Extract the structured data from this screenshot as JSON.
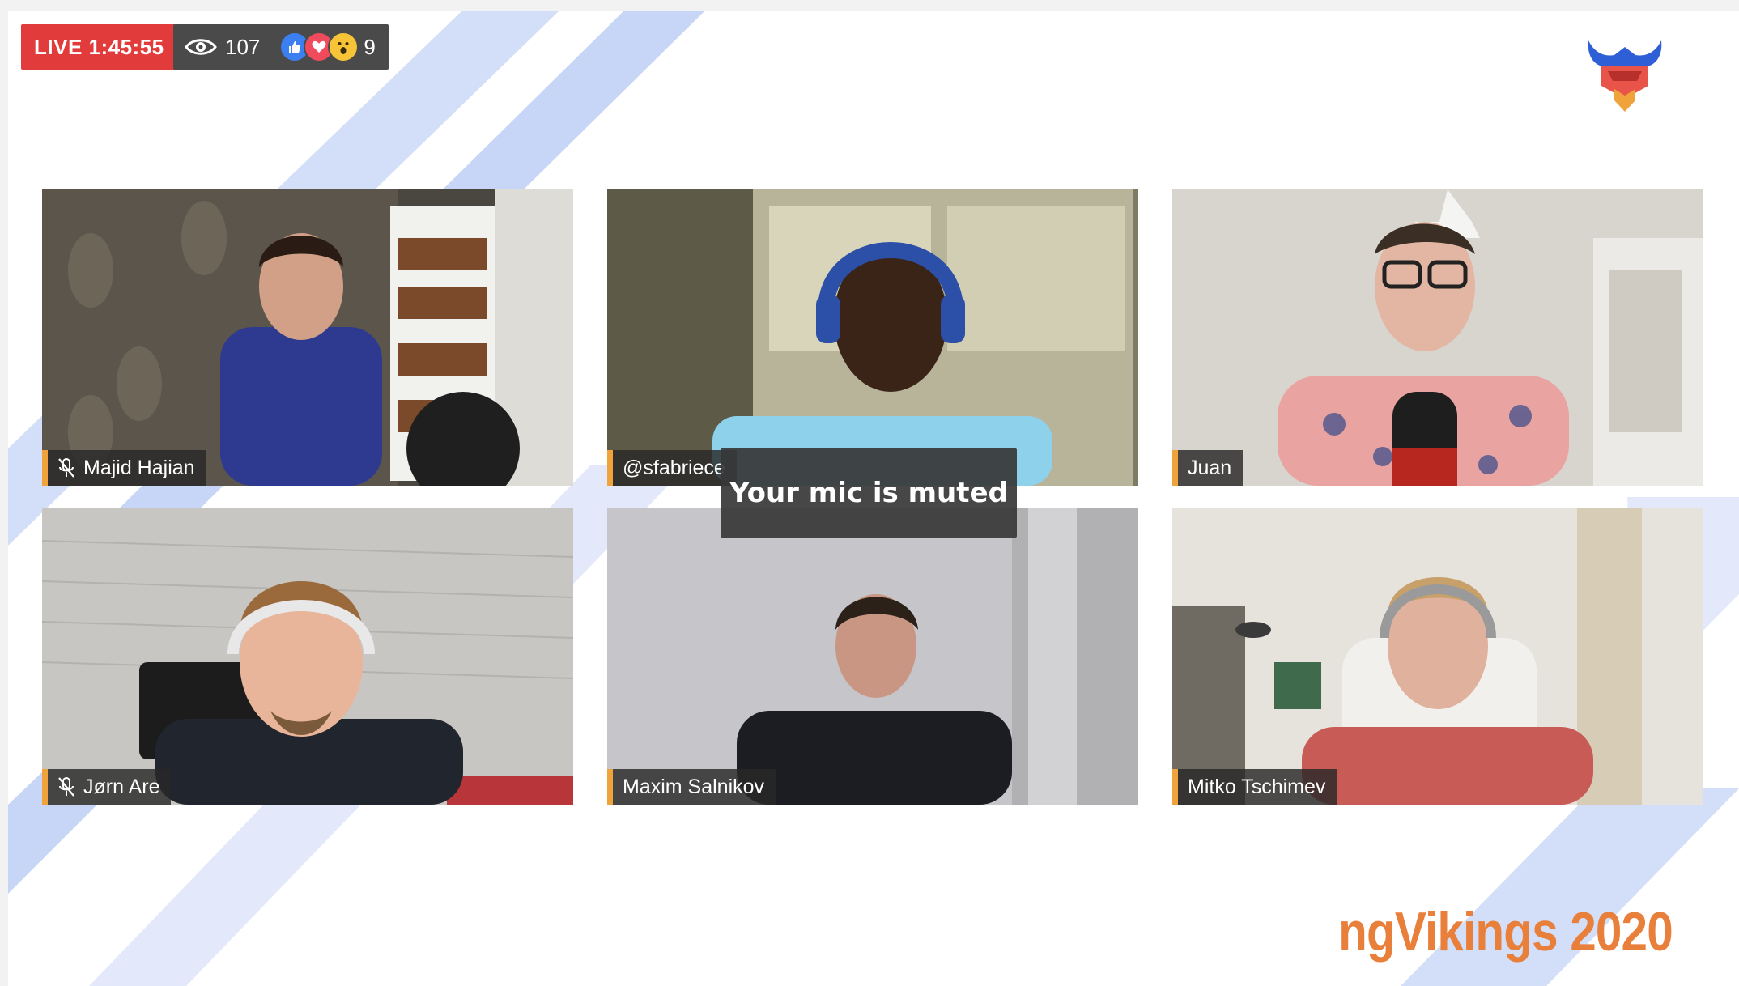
{
  "broadcast": {
    "live_label": "LIVE 1:45:55",
    "viewer_count": "107",
    "reaction_count": "9",
    "reactions": [
      "like-reaction-icon",
      "love-reaction-icon",
      "wow-reaction-icon"
    ]
  },
  "participants": [
    {
      "name": "Majid Hajian",
      "mic_muted": true
    },
    {
      "name": "@sfabriece",
      "mic_muted": false
    },
    {
      "name": "Juan",
      "mic_muted": false
    },
    {
      "name": "Jørn Are",
      "mic_muted": true
    },
    {
      "name": "Maxim Salnikov",
      "mic_muted": false
    },
    {
      "name": "Mitko Tschimev",
      "mic_muted": false
    }
  ],
  "toast": {
    "message": "Your mic is muted"
  },
  "event": {
    "title": "ngVikings 2020"
  },
  "colors": {
    "live_red": "#e23b3b",
    "stats_bg": "#4a4a4a",
    "name_accent": "#f0a33a",
    "title_orange": "#e87f3a",
    "stripe_blue": "#c9d6f5"
  }
}
